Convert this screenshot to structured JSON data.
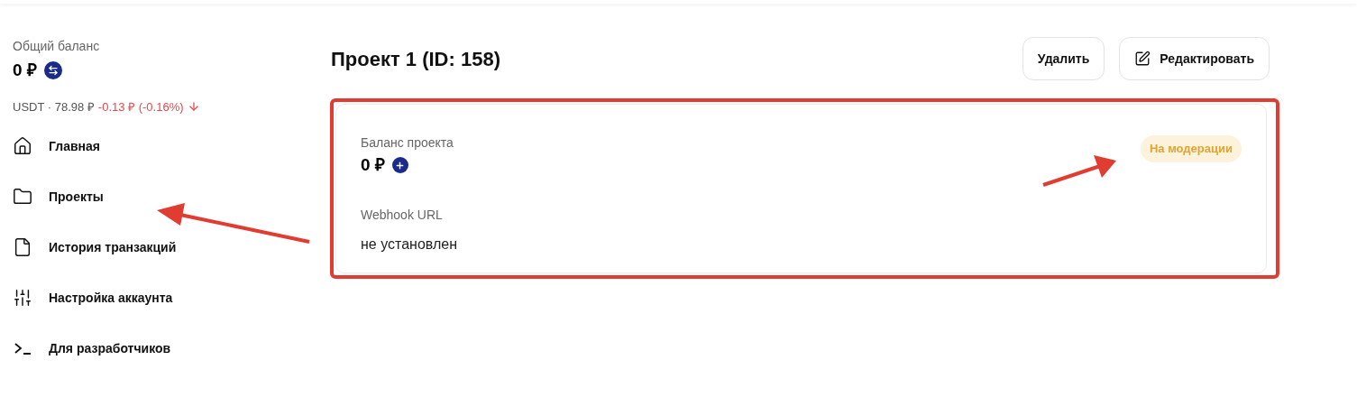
{
  "sidebar": {
    "balance_label": "Общий баланс",
    "balance": "0 ₽",
    "rate": {
      "base": "USDT · 78.98 ₽",
      "change": "-0.13 ₽ (-0.16%)",
      "kind": "down"
    },
    "items": [
      {
        "label": "Главная",
        "kind": "home"
      },
      {
        "label": "Проекты",
        "kind": "folder"
      },
      {
        "label": "История транзакций",
        "kind": "file"
      },
      {
        "label": "Настройка аккаунта",
        "kind": "sliders"
      },
      {
        "label": "Для разработчиков",
        "kind": "terminal"
      }
    ]
  },
  "project": {
    "title": "Проект 1 (ID: 158)",
    "buttons": [
      {
        "label": "Удалить",
        "kind": "plain"
      },
      {
        "label": "Редактировать",
        "kind": "edit"
      }
    ],
    "balance_label": "Баланс проекта",
    "balance": "0 ₽",
    "status": {
      "label": "На модерации",
      "kind": "moderation"
    },
    "webhook_label": "Webhook URL",
    "webhook_value": "не установлен"
  }
}
